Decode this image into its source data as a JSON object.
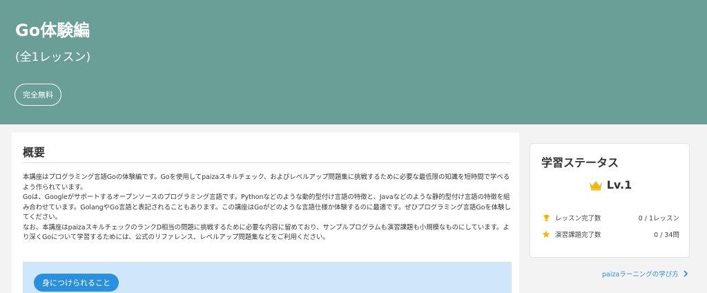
{
  "hero": {
    "title": "Go体験編",
    "subtitle": "(全1レッスン)",
    "badge": "完全無料"
  },
  "overview": {
    "title": "概要",
    "paragraphs": [
      "本講座はプログラミング言語Goの体験編です。Goを使用してpaizaスキルチェック、およびレベルアップ問題集に挑戦するために必要な最低限の知識を短時間で学べるよう作られています。",
      "Goは、Googleがサポートするオープンソースのプログラミング言語です。Pythonなどのような動的型付け言語の特徴と、Javaなどのような静的型付け言語の特徴を組み合わせています。GolangやGo言語と表記されることもあります。この講座はGoがどのような言語仕様か体験するのに最適です。ぜひプログラミング言語Goを体験してください。",
      "なお、本講座はpaizaスキルチェックのランクD相当の問題に挑戦するために必要な内容に留めており、サンプルプログラムも演習課題も小規模なものにしています。より深くGoについて学習するためには、公式のリファレンス、レベルアップ問題集などをご利用ください。"
    ]
  },
  "learn": {
    "pill": "身につけられること"
  },
  "status": {
    "title": "学習ステータス",
    "level": "Lv.1",
    "rows": [
      {
        "icon": "trophy-icon",
        "label": "レッスン完了数",
        "value": "0 / 1レッスン"
      },
      {
        "icon": "star-icon",
        "label": "演習課題完了数",
        "value": "0 / 34問"
      }
    ]
  },
  "link": {
    "label": "paizaラーニングの学び方",
    "icon": "chevron-right-icon"
  },
  "colors": {
    "hero_bg": "#6a9f97",
    "accent_blue": "#2b8fe0",
    "learn_bg": "#cfe6fb",
    "gold": "#f2b705"
  }
}
